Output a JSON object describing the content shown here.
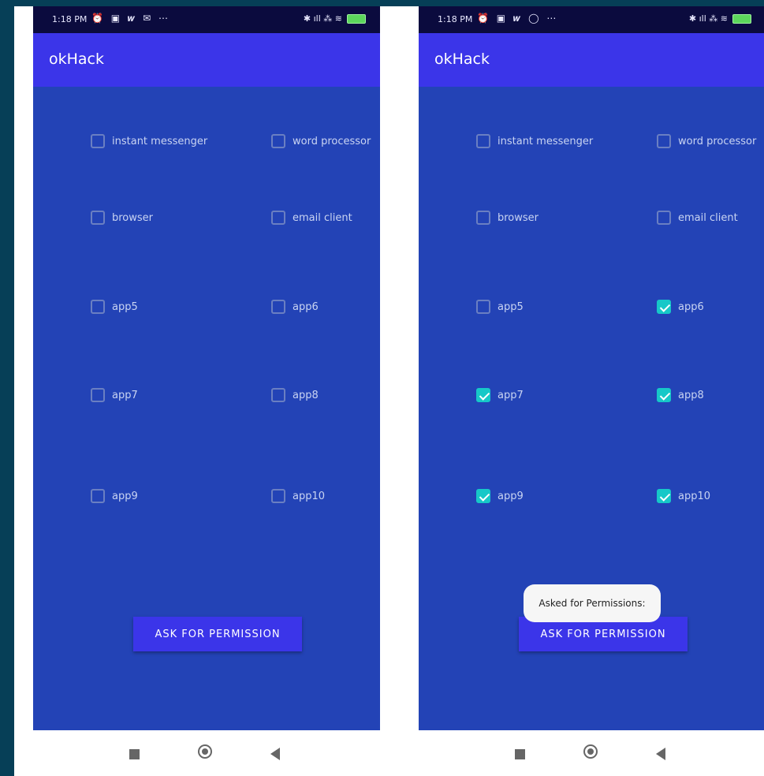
{
  "screens": [
    {
      "status": {
        "time": "1:18 PM",
        "left_icons": "⏰ ▣ 𝒘 ✉ ⋯",
        "right_icons": "✱ ıll ⁂ ≋"
      },
      "app_title": "okHack",
      "checkboxes": [
        {
          "label": "instant messenger",
          "checked": false
        },
        {
          "label": "word processor",
          "checked": false
        },
        {
          "label": "browser",
          "checked": false
        },
        {
          "label": "email client",
          "checked": false
        },
        {
          "label": "app5",
          "checked": false
        },
        {
          "label": "app6",
          "checked": false
        },
        {
          "label": "app7",
          "checked": false
        },
        {
          "label": "app8",
          "checked": false
        },
        {
          "label": "app9",
          "checked": false
        },
        {
          "label": "app10",
          "checked": false
        }
      ],
      "button_label": "ASK FOR PERMISSION",
      "toast": ""
    },
    {
      "status": {
        "time": "1:18 PM",
        "left_icons": "⏰ ▣ 𝒘 ◯ ⋯",
        "right_icons": "✱ ıll ⁂ ≋"
      },
      "app_title": "okHack",
      "checkboxes": [
        {
          "label": "instant messenger",
          "checked": false
        },
        {
          "label": "word processor",
          "checked": false
        },
        {
          "label": "browser",
          "checked": false
        },
        {
          "label": "email client",
          "checked": false
        },
        {
          "label": "app5",
          "checked": false
        },
        {
          "label": "app6",
          "checked": true
        },
        {
          "label": "app7",
          "checked": true
        },
        {
          "label": "app8",
          "checked": true
        },
        {
          "label": "app9",
          "checked": true
        },
        {
          "label": "app10",
          "checked": true
        }
      ],
      "button_label": "ASK FOR PERMISSION",
      "toast": "Asked for Permissions:"
    }
  ],
  "icons": {
    "nav_recents": "square-icon",
    "nav_home": "home-circle-icon",
    "nav_back": "back-triangle-icon",
    "battery": "battery-icon"
  },
  "colors": {
    "app_bar": "#3b35e9",
    "content_bg": "#2343b6",
    "checkbox_checked": "#16c8c8",
    "status_bar": "#0b0b3e"
  }
}
